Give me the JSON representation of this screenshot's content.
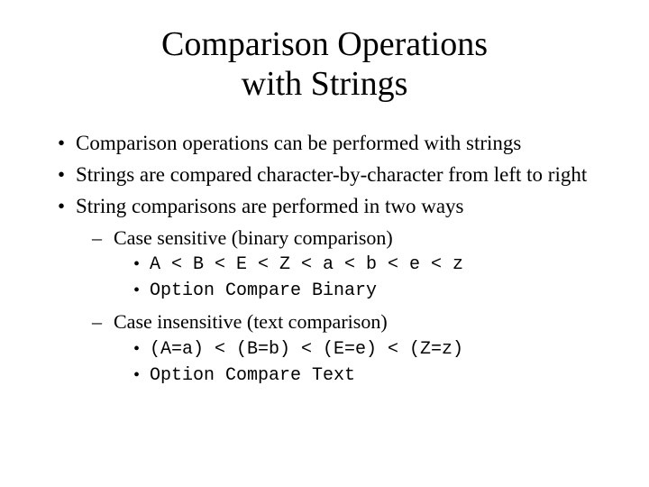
{
  "title_line1": "Comparison Operations",
  "title_line2": "with Strings",
  "bullets": {
    "b1": "Comparison operations can be performed with strings",
    "b2": "Strings are compared character-by-character from left to right",
    "b3": "String comparisons are performed in two ways",
    "b3_sub1": "Case sensitive (binary comparison)",
    "b3_sub1_code1": "A < B < E < Z < a < b < e < z",
    "b3_sub1_code2": "Option Compare Binary",
    "b3_sub2": "Case insensitive (text comparison)",
    "b3_sub2_code1": "(A=a) < (B=b) < (E=e) < (Z=z)",
    "b3_sub2_code2": "Option Compare Text"
  }
}
